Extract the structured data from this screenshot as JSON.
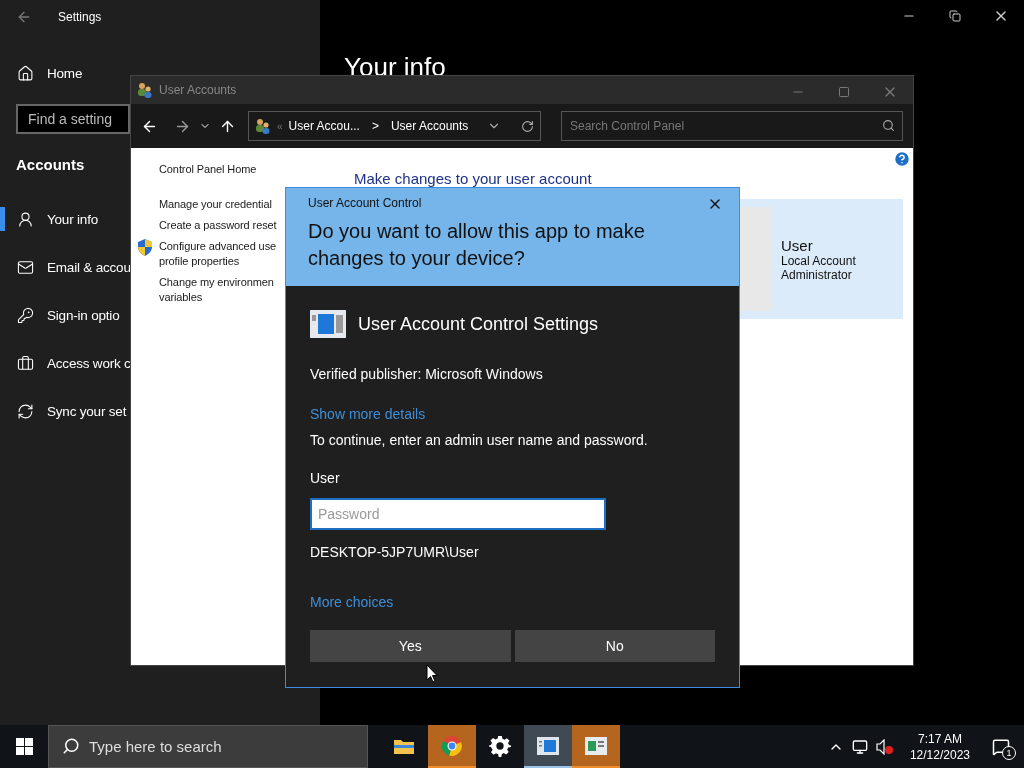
{
  "settings": {
    "title": "Settings",
    "heading": "Your info",
    "nav_home": "Home",
    "search": {
      "placeholder": "Find a setting"
    },
    "section": "Accounts",
    "items": [
      {
        "label": "Your info",
        "selected": true
      },
      {
        "label": "Email & accou",
        "selected": false
      },
      {
        "label": "Sign-in optio",
        "selected": false
      },
      {
        "label": "Access work c",
        "selected": false
      },
      {
        "label": "Sync your set",
        "selected": false
      }
    ]
  },
  "control_panel": {
    "title": "User Accounts",
    "breadcrumb_prefix": "«",
    "breadcrumb": [
      {
        "label": "User Accou..."
      },
      {
        "label": "User Accounts"
      }
    ],
    "breadcrumb_separator": ">",
    "search": {
      "placeholder": "Search Control Panel"
    },
    "sidebar": [
      {
        "lines": [
          "Control Panel Home"
        ],
        "shield": false
      },
      {
        "lines": [
          "Manage your credential"
        ],
        "shield": false
      },
      {
        "lines": [
          "Create a password reset"
        ],
        "shield": false
      },
      {
        "lines": [
          "Configure advanced use",
          "profile properties"
        ],
        "shield": true
      },
      {
        "lines": [
          "Change my environmen",
          "variables"
        ],
        "shield": false
      }
    ],
    "heading": "Make changes to your user account",
    "account": {
      "name": "User",
      "lines": [
        "Local Account",
        "Administrator"
      ]
    }
  },
  "uac": {
    "title": "User Account Control",
    "question": "Do you want to allow this app to make changes to your device?",
    "app_name": "User Account Control Settings",
    "publisher": "Verified publisher: Microsoft Windows",
    "details_link": "Show more details",
    "instruction": "To continue, enter an admin user name and password.",
    "user_label": "User",
    "password": {
      "placeholder": "Password",
      "focused": true
    },
    "account": "DESKTOP-5JP7UMR\\User",
    "more_link": "More choices",
    "buttons": [
      "Yes",
      "No"
    ]
  },
  "taskbar": {
    "search": {
      "placeholder": "Type here to search"
    },
    "apps": [
      {
        "flashing": false,
        "selected": false
      },
      {
        "flashing": true,
        "selected": false
      },
      {
        "flashing": false,
        "selected": false
      },
      {
        "flashing": false,
        "selected": true
      },
      {
        "flashing": true,
        "selected": false
      }
    ],
    "time": "7:17 AM",
    "date": "12/12/2023",
    "notifications": "1"
  }
}
